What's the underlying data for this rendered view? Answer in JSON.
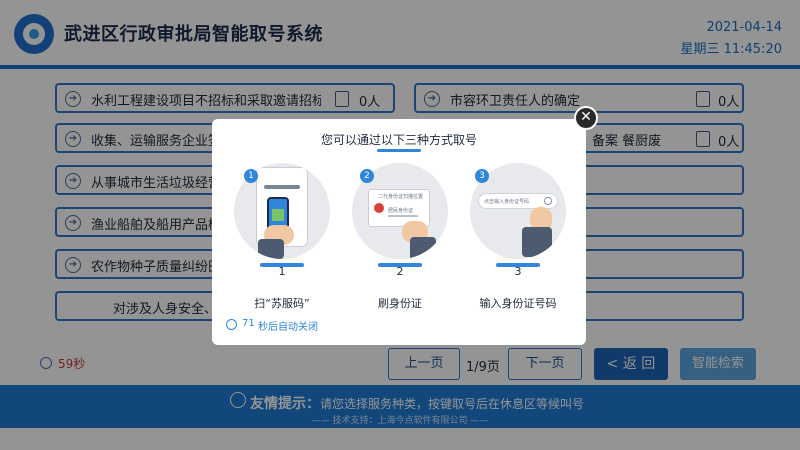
{
  "header": {
    "title": "武进区行政审批局智能取号系统",
    "date": "2021-04-14",
    "weekday_time": "星期三 11:45:20"
  },
  "services": [
    {
      "label": "水利工程建设项目不招标和采取邀请招标方",
      "count": "0人"
    },
    {
      "label": "市容环卫责任人的确定",
      "count": "0人"
    },
    {
      "label": "收集、运输服务企业签订",
      "count": ""
    },
    {
      "label": "备案    餐厨废",
      "count": "0人"
    },
    {
      "label": "从事城市生活垃圾经营性",
      "count": ""
    },
    {
      "label": "渔业船舶及船用产品检验",
      "count": ""
    },
    {
      "label": "农作物种子质量纠纷田间",
      "count": ""
    },
    {
      "label": "对涉及人身安全、珍",
      "count": ""
    }
  ],
  "pager": {
    "countdown": "59秒",
    "prev_label": "上一页",
    "page_indicator": "1/9页",
    "next_label": "下一页",
    "back_label": "< 返 回",
    "smart_search_label": "智能检索"
  },
  "footer": {
    "tip_title": "友情提示：",
    "tip_text": "请您选择服务种类，按键取号后在休息区等候叫号",
    "support": "——  技术支持：上海今点软件有限公司  ——"
  },
  "modal": {
    "title": "您可以通过以下三种方式取号",
    "close_icon": "close-icon",
    "methods": [
      {
        "badge": "1",
        "number": "1",
        "label": "扫“苏服码”",
        "illustration": "scan-code-icon"
      },
      {
        "badge": "2",
        "number": "2",
        "label": "刷身份证",
        "illustration": "id-card-icon"
      },
      {
        "badge": "3",
        "number": "3",
        "label": "输入身份证号码",
        "illustration": "keyboard-input-icon"
      }
    ],
    "card_caption": "二代身份证扫描位置",
    "card_inner": "居民身份证",
    "search_placeholder": "点击输入身份证号码",
    "auto_close_seconds": "71",
    "auto_close_text": "秒后自动关闭"
  },
  "colors": {
    "primary": "#1e7bd4",
    "accent": "#2f86dc",
    "dark_button": "#1b64b6",
    "countdown": "#c33a3a"
  }
}
